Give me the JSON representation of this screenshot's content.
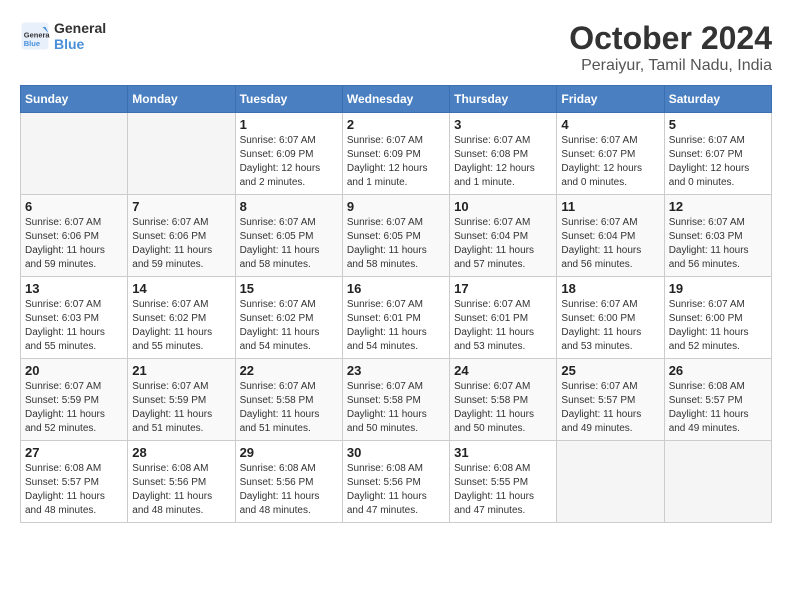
{
  "header": {
    "logo_general": "General",
    "logo_blue": "Blue",
    "month": "October 2024",
    "location": "Peraiyur, Tamil Nadu, India"
  },
  "days_of_week": [
    "Sunday",
    "Monday",
    "Tuesday",
    "Wednesday",
    "Thursday",
    "Friday",
    "Saturday"
  ],
  "weeks": [
    [
      {
        "day": "",
        "empty": true
      },
      {
        "day": "",
        "empty": true
      },
      {
        "day": "1",
        "sunrise": "Sunrise: 6:07 AM",
        "sunset": "Sunset: 6:09 PM",
        "daylight": "Daylight: 12 hours and 2 minutes."
      },
      {
        "day": "2",
        "sunrise": "Sunrise: 6:07 AM",
        "sunset": "Sunset: 6:09 PM",
        "daylight": "Daylight: 12 hours and 1 minute."
      },
      {
        "day": "3",
        "sunrise": "Sunrise: 6:07 AM",
        "sunset": "Sunset: 6:08 PM",
        "daylight": "Daylight: 12 hours and 1 minute."
      },
      {
        "day": "4",
        "sunrise": "Sunrise: 6:07 AM",
        "sunset": "Sunset: 6:07 PM",
        "daylight": "Daylight: 12 hours and 0 minutes."
      },
      {
        "day": "5",
        "sunrise": "Sunrise: 6:07 AM",
        "sunset": "Sunset: 6:07 PM",
        "daylight": "Daylight: 12 hours and 0 minutes."
      }
    ],
    [
      {
        "day": "6",
        "sunrise": "Sunrise: 6:07 AM",
        "sunset": "Sunset: 6:06 PM",
        "daylight": "Daylight: 11 hours and 59 minutes."
      },
      {
        "day": "7",
        "sunrise": "Sunrise: 6:07 AM",
        "sunset": "Sunset: 6:06 PM",
        "daylight": "Daylight: 11 hours and 59 minutes."
      },
      {
        "day": "8",
        "sunrise": "Sunrise: 6:07 AM",
        "sunset": "Sunset: 6:05 PM",
        "daylight": "Daylight: 11 hours and 58 minutes."
      },
      {
        "day": "9",
        "sunrise": "Sunrise: 6:07 AM",
        "sunset": "Sunset: 6:05 PM",
        "daylight": "Daylight: 11 hours and 58 minutes."
      },
      {
        "day": "10",
        "sunrise": "Sunrise: 6:07 AM",
        "sunset": "Sunset: 6:04 PM",
        "daylight": "Daylight: 11 hours and 57 minutes."
      },
      {
        "day": "11",
        "sunrise": "Sunrise: 6:07 AM",
        "sunset": "Sunset: 6:04 PM",
        "daylight": "Daylight: 11 hours and 56 minutes."
      },
      {
        "day": "12",
        "sunrise": "Sunrise: 6:07 AM",
        "sunset": "Sunset: 6:03 PM",
        "daylight": "Daylight: 11 hours and 56 minutes."
      }
    ],
    [
      {
        "day": "13",
        "sunrise": "Sunrise: 6:07 AM",
        "sunset": "Sunset: 6:03 PM",
        "daylight": "Daylight: 11 hours and 55 minutes."
      },
      {
        "day": "14",
        "sunrise": "Sunrise: 6:07 AM",
        "sunset": "Sunset: 6:02 PM",
        "daylight": "Daylight: 11 hours and 55 minutes."
      },
      {
        "day": "15",
        "sunrise": "Sunrise: 6:07 AM",
        "sunset": "Sunset: 6:02 PM",
        "daylight": "Daylight: 11 hours and 54 minutes."
      },
      {
        "day": "16",
        "sunrise": "Sunrise: 6:07 AM",
        "sunset": "Sunset: 6:01 PM",
        "daylight": "Daylight: 11 hours and 54 minutes."
      },
      {
        "day": "17",
        "sunrise": "Sunrise: 6:07 AM",
        "sunset": "Sunset: 6:01 PM",
        "daylight": "Daylight: 11 hours and 53 minutes."
      },
      {
        "day": "18",
        "sunrise": "Sunrise: 6:07 AM",
        "sunset": "Sunset: 6:00 PM",
        "daylight": "Daylight: 11 hours and 53 minutes."
      },
      {
        "day": "19",
        "sunrise": "Sunrise: 6:07 AM",
        "sunset": "Sunset: 6:00 PM",
        "daylight": "Daylight: 11 hours and 52 minutes."
      }
    ],
    [
      {
        "day": "20",
        "sunrise": "Sunrise: 6:07 AM",
        "sunset": "Sunset: 5:59 PM",
        "daylight": "Daylight: 11 hours and 52 minutes."
      },
      {
        "day": "21",
        "sunrise": "Sunrise: 6:07 AM",
        "sunset": "Sunset: 5:59 PM",
        "daylight": "Daylight: 11 hours and 51 minutes."
      },
      {
        "day": "22",
        "sunrise": "Sunrise: 6:07 AM",
        "sunset": "Sunset: 5:58 PM",
        "daylight": "Daylight: 11 hours and 51 minutes."
      },
      {
        "day": "23",
        "sunrise": "Sunrise: 6:07 AM",
        "sunset": "Sunset: 5:58 PM",
        "daylight": "Daylight: 11 hours and 50 minutes."
      },
      {
        "day": "24",
        "sunrise": "Sunrise: 6:07 AM",
        "sunset": "Sunset: 5:58 PM",
        "daylight": "Daylight: 11 hours and 50 minutes."
      },
      {
        "day": "25",
        "sunrise": "Sunrise: 6:07 AM",
        "sunset": "Sunset: 5:57 PM",
        "daylight": "Daylight: 11 hours and 49 minutes."
      },
      {
        "day": "26",
        "sunrise": "Sunrise: 6:08 AM",
        "sunset": "Sunset: 5:57 PM",
        "daylight": "Daylight: 11 hours and 49 minutes."
      }
    ],
    [
      {
        "day": "27",
        "sunrise": "Sunrise: 6:08 AM",
        "sunset": "Sunset: 5:57 PM",
        "daylight": "Daylight: 11 hours and 48 minutes."
      },
      {
        "day": "28",
        "sunrise": "Sunrise: 6:08 AM",
        "sunset": "Sunset: 5:56 PM",
        "daylight": "Daylight: 11 hours and 48 minutes."
      },
      {
        "day": "29",
        "sunrise": "Sunrise: 6:08 AM",
        "sunset": "Sunset: 5:56 PM",
        "daylight": "Daylight: 11 hours and 48 minutes."
      },
      {
        "day": "30",
        "sunrise": "Sunrise: 6:08 AM",
        "sunset": "Sunset: 5:56 PM",
        "daylight": "Daylight: 11 hours and 47 minutes."
      },
      {
        "day": "31",
        "sunrise": "Sunrise: 6:08 AM",
        "sunset": "Sunset: 5:55 PM",
        "daylight": "Daylight: 11 hours and 47 minutes."
      },
      {
        "day": "",
        "empty": true
      },
      {
        "day": "",
        "empty": true
      }
    ]
  ]
}
